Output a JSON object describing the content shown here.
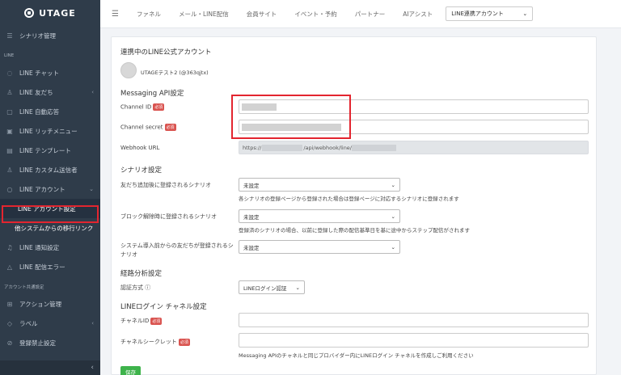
{
  "brand": {
    "name": "UTAGE"
  },
  "sidebar": {
    "scenario": "シナリオ管理",
    "section_line": "LINE",
    "items": [
      {
        "label": "LINE チャット",
        "icon": "chat-icon"
      },
      {
        "label": "LINE 友だち",
        "icon": "user-icon",
        "chevron": "‹"
      },
      {
        "label": "LINE 自動応答",
        "icon": "reply-icon"
      },
      {
        "label": "LINE リッチメニュー",
        "icon": "menu-icon"
      },
      {
        "label": "LINE テンプレート",
        "icon": "template-icon"
      },
      {
        "label": "LINE カスタム送信者",
        "icon": "user-icon"
      },
      {
        "label": "LINE アカウント",
        "icon": "account-icon",
        "chevron": "⌄"
      }
    ],
    "sub_active": "LINE アカウント設定",
    "sub_other": "他システムからの移行リンク",
    "items2": [
      {
        "label": "LINE 通知設定",
        "icon": "bell-icon"
      },
      {
        "label": "LINE 配信エラー",
        "icon": "warning-icon"
      }
    ],
    "section_account": "アカウント共通設定",
    "items3": [
      {
        "label": "アクション管理",
        "icon": "grid-icon"
      },
      {
        "label": "ラベル",
        "icon": "tag-icon",
        "chevron": "‹"
      },
      {
        "label": "登録禁止設定",
        "icon": "block-icon"
      }
    ],
    "collapse": "‹"
  },
  "topbar": {
    "menu": [
      "ファネル",
      "メール・LINE配信",
      "会員サイト",
      "イベント・予約",
      "パートナー",
      "AIアシスト"
    ],
    "account_select": "LINE連携アカウント"
  },
  "card": {
    "linked_title": "連携中のLINE公式アカウント",
    "account_name": "UTAGEテスト2 (@363qjtx)",
    "api_title": "Messaging API設定",
    "channel_id_label": "Channel ID",
    "channel_secret_label": "Channel secret",
    "required": "必須",
    "webhook_label": "Webhook URL",
    "webhook_prefix": "https://",
    "webhook_middle": "/api/webhook/line/",
    "scenario_title": "シナリオ設定",
    "friend_add_label": "友だち追加後に登録されるシナリオ",
    "unset": "未設定",
    "friend_add_hint": "各シナリオの登録ページから登録された場合は登録ページに対応するシナリオに登録されます",
    "unblock_label": "ブロック解除時に登録されるシナリオ",
    "unblock_hint": "登録済のシナリオの場合、以前に登録した際の配信基準日を基に途中からステップ配信がされます",
    "preexisting_label": "システム導入前からの友だちが登録されるシナリオ",
    "route_title": "経路分析設定",
    "auth_label": "認証方式 ⓘ",
    "auth_value": "LINEログイン認証",
    "login_title": "LINEログイン チャネル設定",
    "login_channel_id": "チャネルID",
    "login_channel_secret": "チャネルシークレット",
    "login_hint": "Messaging APIのチャネルと同じプロバイダー内にLINEログイン チャネルを作成しご利用ください",
    "save": "保存"
  },
  "colors": {
    "sidebar_bg": "#2f3c4a",
    "required_badge": "#d9534f",
    "save_button": "#3eb34b",
    "highlight_box": "#e3252f"
  }
}
